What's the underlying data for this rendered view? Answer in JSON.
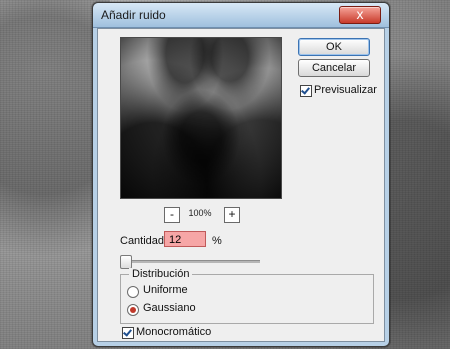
{
  "window": {
    "title": "Añadir ruido",
    "close_glyph": "x"
  },
  "buttons": {
    "ok": "OK",
    "cancel": "Cancelar"
  },
  "preview": {
    "zoom": "100%",
    "minus": "-",
    "plus": "+"
  },
  "options": {
    "preview_checkbox": {
      "label": "Previsualizar",
      "checked": true
    },
    "amount": {
      "label": "Cantidad:",
      "value": "12",
      "unit": "%"
    },
    "distribution": {
      "title": "Distribución",
      "uniform": {
        "label": "Uniforme",
        "selected": false
      },
      "gaussian": {
        "label": "Gaussiano",
        "selected": true
      }
    },
    "monochrome": {
      "label": "Monocromático",
      "checked": true
    }
  }
}
